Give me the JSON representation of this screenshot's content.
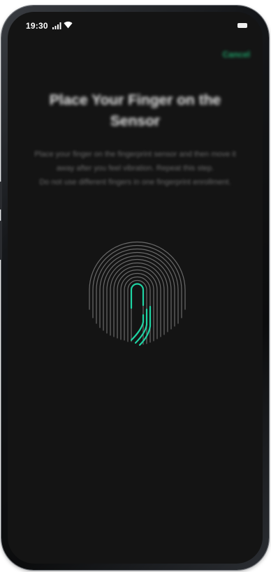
{
  "status_bar": {
    "time": "19:30"
  },
  "header": {
    "cancel_label": "Cancel"
  },
  "main": {
    "title": "Place Your Finger on the Sensor",
    "instruction_1": "Place your finger on the fingerprint sensor and then move it away after you feel vibration. Repeat this step.",
    "instruction_2": "Do not use different fingers in one fingerprint enrollment."
  },
  "icons": {
    "signal": "signal-icon",
    "wifi": "wifi-icon",
    "battery": "battery-icon",
    "fingerprint": "fingerprint-icon"
  },
  "colors": {
    "accent": "#1fd4a4",
    "background": "#141414"
  }
}
